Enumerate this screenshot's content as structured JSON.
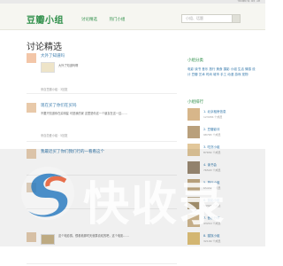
{
  "topbar": {
    "right_text": "下载豆瓣客户端 · 登录 · 注册"
  },
  "header": {
    "logo": "豆瓣小组",
    "nav": [
      "讨论精选",
      "热门小组"
    ],
    "search_placeholder": "小组、话题"
  },
  "page_title": "讨论精选",
  "posts": [
    {
      "title": "大外了知道吗",
      "thumb_caption": "大外了知道吗啊",
      "meta": "来自豆瓣小组 · 3回复"
    },
    {
      "title": "现在买了你们在买吗",
      "body": "不要只知道你在买明星 可是我的家 这里是你这一个朋友在这一边……",
      "meta": "来自恋爱小组 · 5回复"
    },
    {
      "title": "我最近买了你们我们行的一看看这个",
      "body": "",
      "meta": ""
    },
    {
      "title": "",
      "body": "",
      "meta": ""
    },
    {
      "title": "",
      "body": "这个电影感，很看着那时天就算喜欢的吧，这个电影……",
      "meta": ""
    }
  ],
  "sidebar": {
    "groups_title": "小组分类",
    "tags": [
      "电影",
      "读书",
      "音乐",
      "旅行",
      "美食",
      "摄影",
      "小组",
      "生活",
      "情感",
      "设计",
      "豆瓣",
      "艺术",
      "时尚",
      "城市",
      "手工",
      "动漫",
      "游戏",
      "宠物"
    ],
    "rank_title": "小组排行",
    "rank": [
      {
        "name": "1. 北京租房信息",
        "sub": "123456 个成员"
      },
      {
        "name": "2. 豆瓣影评",
        "sub": "98765 个成员"
      },
      {
        "name": "3. 吃货小组",
        "sub": "87654 个成员"
      },
      {
        "name": "4. 读书会",
        "sub": "76543 个成员"
      },
      {
        "name": "5. 旅行小组",
        "sub": "65432 个成员"
      },
      {
        "name": "6. 摄影小组",
        "sub": "54321 个成员"
      },
      {
        "name": "7. 音乐分享",
        "sub": "43210 个成员"
      },
      {
        "name": "8. 猫奴小组",
        "sub": "32109 个成员"
      }
    ]
  },
  "watermark": "快收录",
  "colors": {
    "brand": "#2f8f4a",
    "link": "#3377aa"
  }
}
